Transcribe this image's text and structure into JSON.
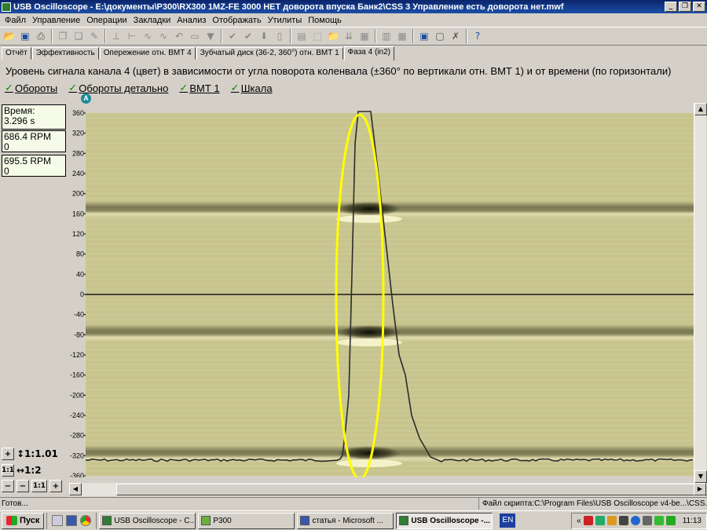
{
  "window": {
    "title": "USB Oscilloscope - E:\\документы\\P300\\RX300 1MZ-FE 3000 НЕТ доворота впуска Банк2\\CSS 3 Управление есть доворота нет.mwf",
    "btn_min": "_",
    "btn_max": "❐",
    "btn_close": "✕"
  },
  "menu": [
    "Файл",
    "Управление",
    "Операции",
    "Закладки",
    "Анализ",
    "Отображать",
    "Утилиты",
    "Помощь"
  ],
  "tabs": [
    {
      "label": "Отчёт"
    },
    {
      "label": "Эффективность"
    },
    {
      "label": "Опережение отн. ВМТ 4"
    },
    {
      "label": "Зубчатый диск (36-2, 360°) отн. ВМТ 1"
    },
    {
      "label": "Фаза 4 (in2)"
    }
  ],
  "heading": "Уровень сигнала канала 4 (цвет) в зависимости от угла поворота коленвала (±360° по вертикали отн. ВМТ 1) и от времени (по горизонтали)",
  "checkboxes": [
    {
      "label": "Обороты",
      "mark": "✓"
    },
    {
      "label": "Обороты детально",
      "mark": "✓"
    },
    {
      "label": "ВМТ 1",
      "mark": "✓"
    },
    {
      "label": "Шкала",
      "mark": "✓"
    }
  ],
  "marker": "A",
  "info": {
    "time_label": "Время:",
    "time_value": "3.296 s",
    "rpm1": "686.4 RPM",
    "rpm1_sub": "0",
    "rpm2": "695.5 RPM",
    "rpm2_sub": "0"
  },
  "zoom": {
    "plus": "+",
    "minus": "−",
    "v_ratio": "↕1:1.01",
    "one_one": "1:1",
    "h_ratio": "↔1:2"
  },
  "chart_data": {
    "type": "heatmap",
    "y_ticks": [
      360,
      320,
      280,
      240,
      200,
      160,
      120,
      80,
      40,
      0,
      -40,
      -80,
      -120,
      -160,
      -200,
      -240,
      -280,
      -320,
      -360
    ],
    "ylim": [
      -360,
      360
    ],
    "dark_bands_deg": [
      170,
      -75,
      -315
    ],
    "colors": {
      "background": "#c9c48f",
      "grid": "#c8d89a",
      "band": "#2a2a14",
      "highlight": "#f8f6d0",
      "ellipse": "#ffff00",
      "trace": "#2b2b2b"
    }
  },
  "status": {
    "left": "Готов...",
    "right": "Файл скрипта:C:\\Program Files\\USB Oscilloscope v4-be...\\CSS.asc"
  },
  "taskbar": {
    "start": "Пуск",
    "tasks": [
      "USB Oscilloscope - C...",
      "P300",
      "статья - Microsoft ...",
      "USB Oscilloscope -..."
    ],
    "lang": "EN",
    "clock": "11:13"
  }
}
